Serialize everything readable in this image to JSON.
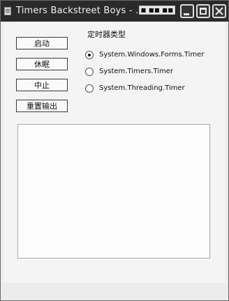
{
  "window": {
    "title": "Timers Backstreet Boys - ...",
    "ime_indicator": "■ ■■ ■■"
  },
  "buttons": {
    "start": "启动",
    "sleep": "休眠",
    "stop": "中止",
    "reset_output": "重置输出"
  },
  "timer_type": {
    "label": "定时器类型",
    "options": [
      {
        "label": "System.Windows.Forms.Timer",
        "checked": true
      },
      {
        "label": "System.Timers.Timer",
        "checked": false
      },
      {
        "label": "System.Threading.Timer",
        "checked": false
      }
    ]
  },
  "output": {
    "text": ""
  },
  "icons": {
    "app": "window-app-icon",
    "minimize": "minimize-icon",
    "maximize": "maximize-icon",
    "close": "close-icon"
  }
}
